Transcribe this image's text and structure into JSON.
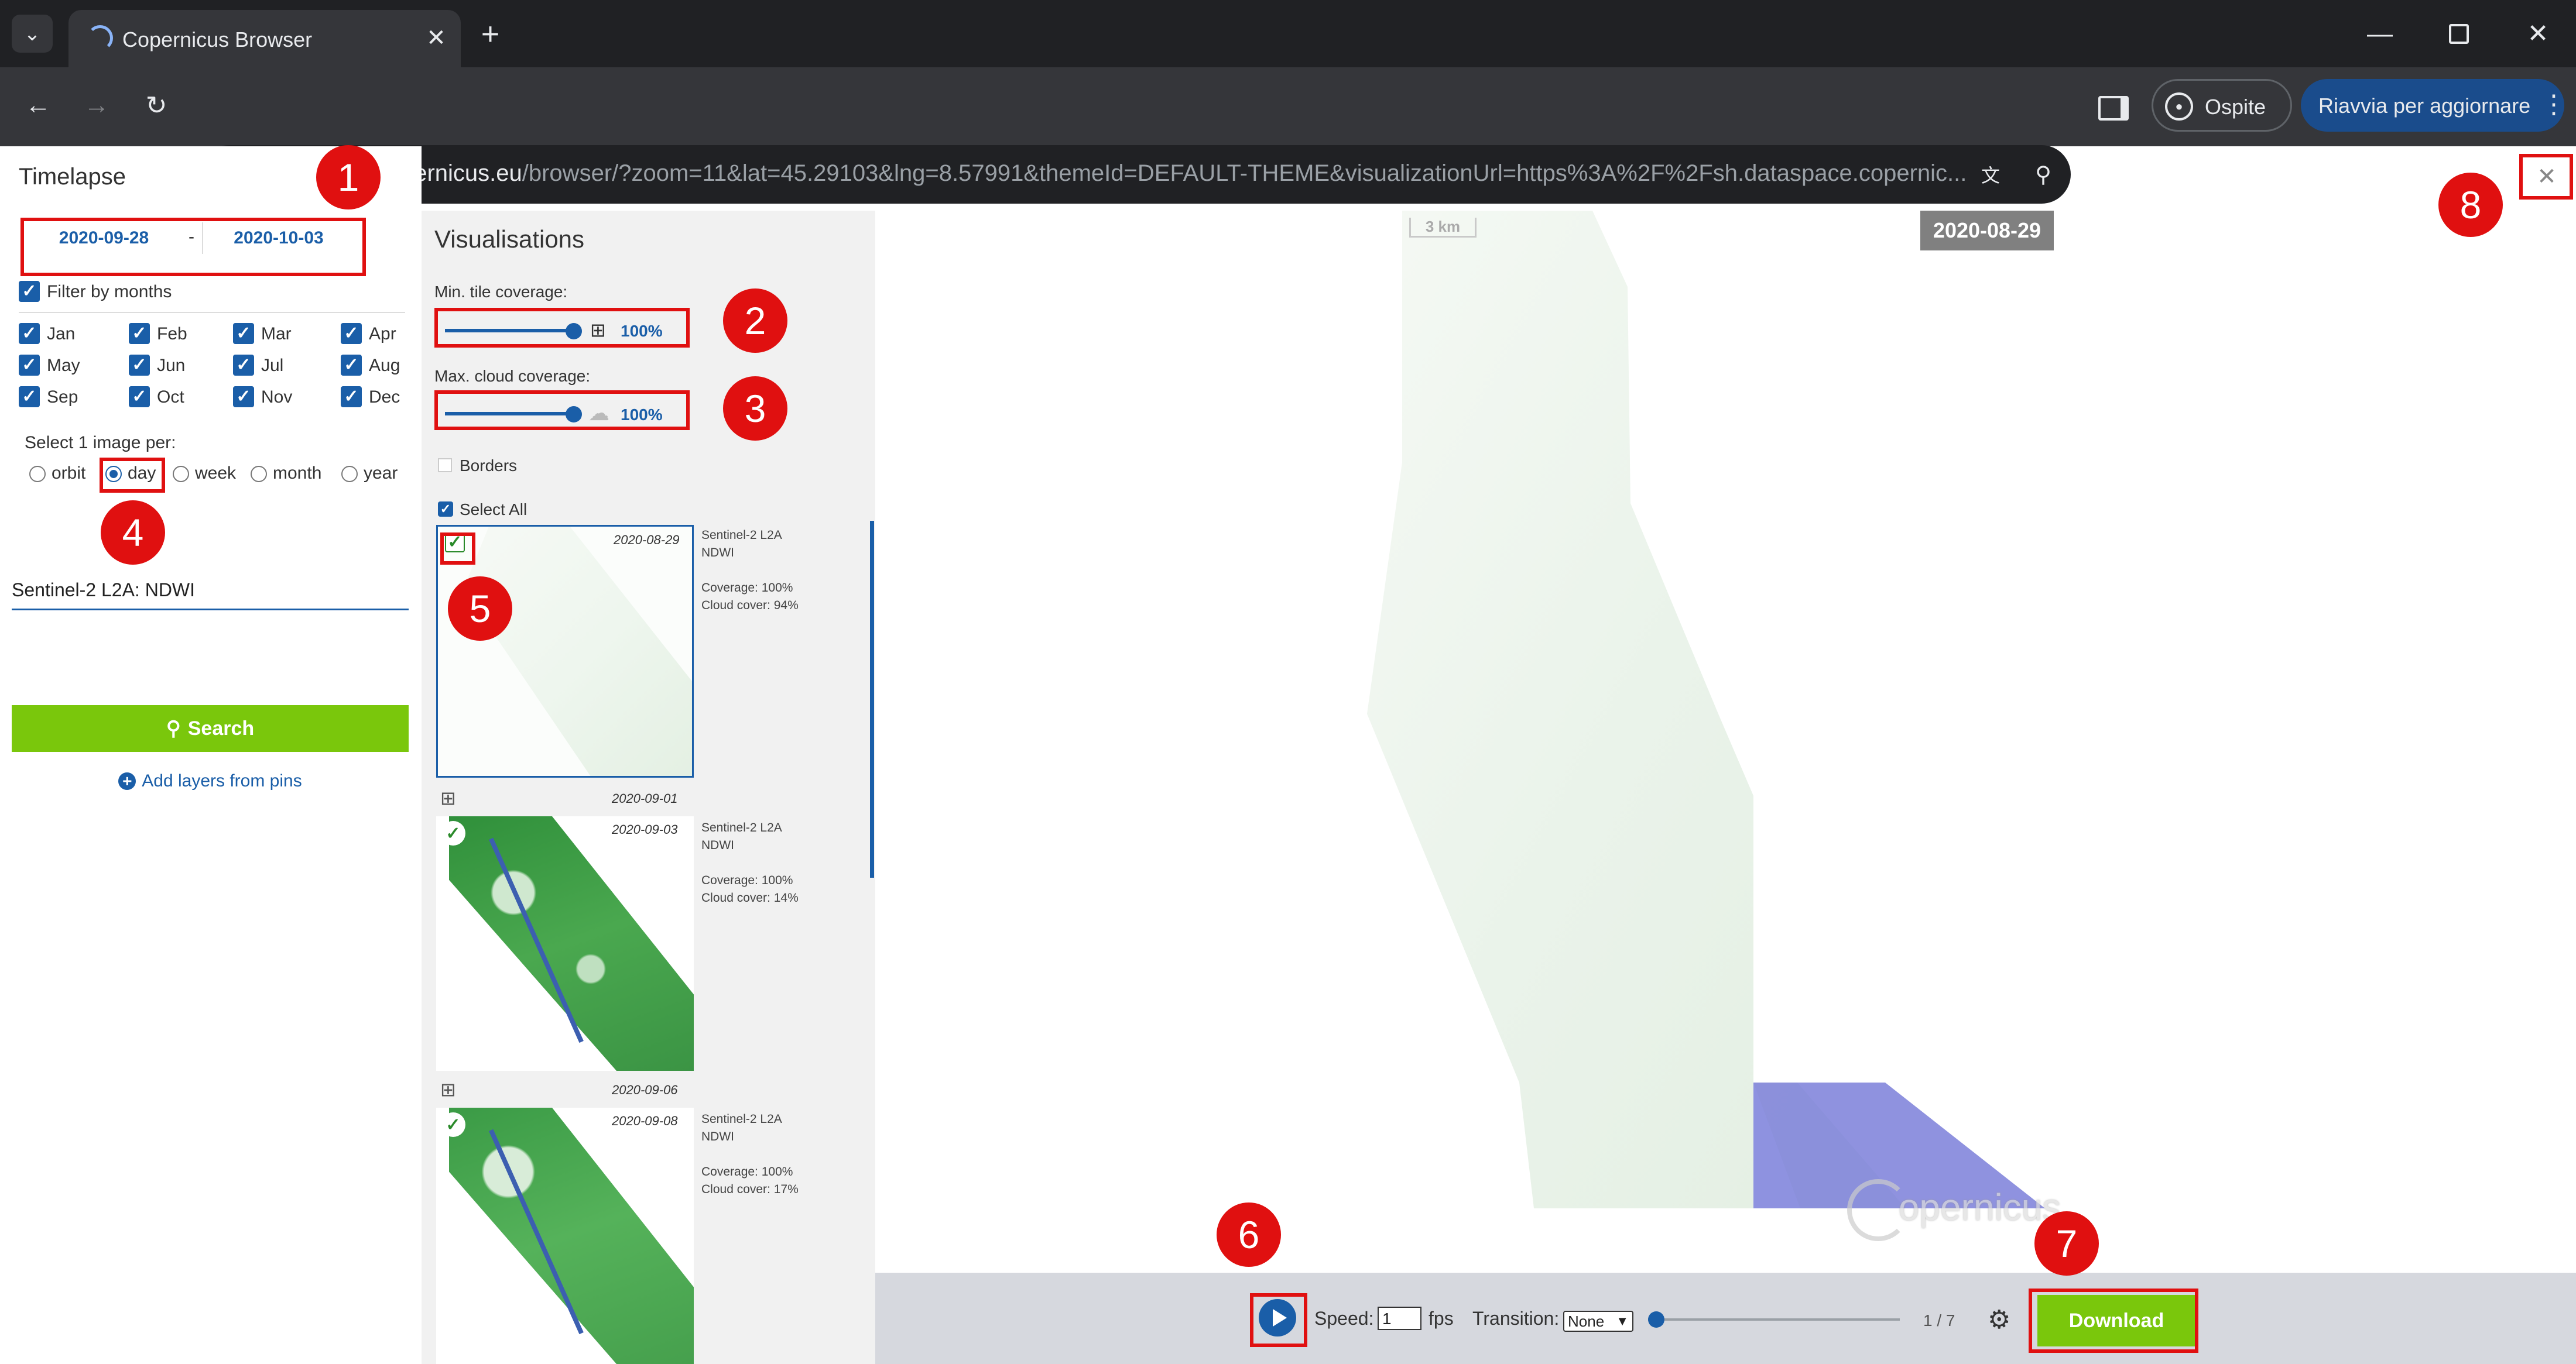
{
  "browser": {
    "tab_title": "Copernicus Browser",
    "url_host": "dataspace.copernicus.eu",
    "url_path": "/browser/?zoom=11&lat=45.29103&lng=8.57991&themeId=DEFAULT-THEME&visualizationUrl=https%3A%2F%2Fsh.dataspace.copernic...",
    "guest_label": "Ospite",
    "update_label": "Riavvia per aggiornare"
  },
  "timelapse": {
    "title": "Timelapse",
    "date_from": "2020-09-28",
    "date_sep": "-",
    "date_to": "2020-10-03",
    "filter_months_label": "Filter by months",
    "months": [
      "Jan",
      "Feb",
      "Mar",
      "Apr",
      "May",
      "Jun",
      "Jul",
      "Aug",
      "Sep",
      "Oct",
      "Nov",
      "Dec"
    ],
    "select_per_label": "Select 1 image per:",
    "select_per_options": [
      "orbit",
      "day",
      "week",
      "month",
      "year"
    ],
    "select_per_selected": "day",
    "layer_name": "Sentinel-2 L2A: NDWI",
    "search_label": "Search",
    "add_layers_label": "Add layers from pins"
  },
  "visualisations": {
    "title": "Visualisations",
    "min_tile_label": "Min. tile coverage:",
    "min_tile_value": "100%",
    "min_tile_fraction": 1.0,
    "max_cloud_label": "Max. cloud coverage:",
    "max_cloud_value": "100%",
    "max_cloud_fraction": 1.0,
    "borders_label": "Borders",
    "select_all_label": "Select All",
    "items": [
      {
        "date": "2020-08-29",
        "source": "Sentinel-2 L2A",
        "layer": "NDWI",
        "coverage": "Coverage: 100%",
        "cloud": "Cloud cover: 94%"
      },
      {
        "header_date": "2020-09-01",
        "date": "2020-09-03",
        "source": "Sentinel-2 L2A",
        "layer": "NDWI",
        "coverage": "Coverage: 100%",
        "cloud": "Cloud cover: 14%"
      },
      {
        "header_date": "2020-09-06",
        "date": "2020-09-08",
        "source": "Sentinel-2 L2A",
        "layer": "NDWI",
        "coverage": "Coverage: 100%",
        "cloud": "Cloud cover: 17%"
      }
    ]
  },
  "preview": {
    "date_label": "2020-08-29",
    "scale_label": "3 km",
    "logo_text": "opernicus"
  },
  "player": {
    "speed_label": "Speed:",
    "speed_value": "1",
    "fps_label": "fps",
    "transition_label": "Transition:",
    "transition_value": "None",
    "frame_label": "1 / 7",
    "frame_fraction": 0.0,
    "download_label": "Download"
  },
  "annotations": [
    "1",
    "2",
    "3",
    "4",
    "5",
    "6",
    "7",
    "8"
  ],
  "colors": {
    "accent_blue": "#1a5ea8",
    "search_green": "#7ac70c",
    "annotation_red": "#e01010",
    "ndwi_green": "#3c9a45",
    "water_blue": "#7b7fd9"
  }
}
